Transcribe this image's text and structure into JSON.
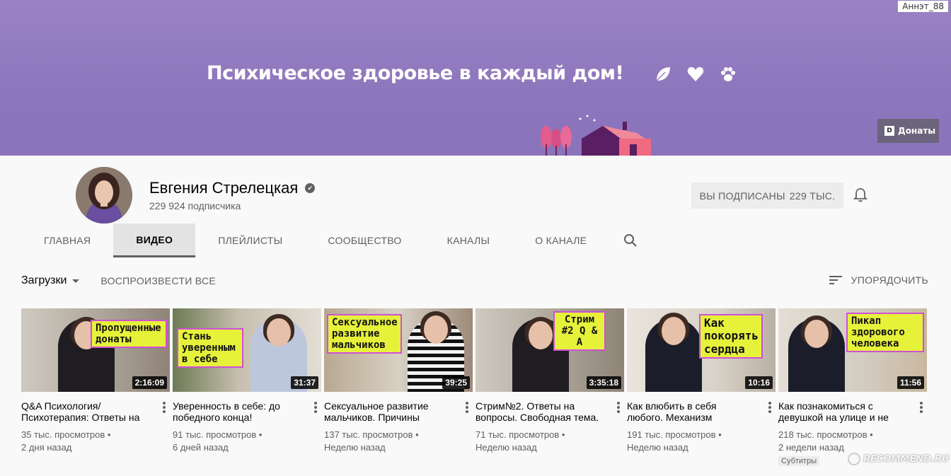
{
  "banner": {
    "tagline": "Психическое здоровье в каждый дом!",
    "user_label": "Аннэт_88",
    "donate_label": "Донаты",
    "donate_logo": "D",
    "icons": [
      "leaf-icon",
      "heart-icon",
      "paw-icon"
    ],
    "bg_color": "#9a82c4"
  },
  "channel": {
    "name": "Евгения Стрелецкая",
    "subscribers": "229 924 подписчика",
    "subscribed_label": "ВЫ ПОДПИСАНЫ",
    "subscribed_count": "229 ТЫС."
  },
  "tabs": [
    {
      "label": "ГЛАВНАЯ",
      "active": false
    },
    {
      "label": "ВИДЕО",
      "active": true
    },
    {
      "label": "ПЛЕЙЛИСТЫ",
      "active": false
    },
    {
      "label": "СООБЩЕСТВО",
      "active": false
    },
    {
      "label": "КАНАЛЫ",
      "active": false
    },
    {
      "label": "О КАНАЛЕ",
      "active": false
    }
  ],
  "filters": {
    "uploads": "Загрузки",
    "play_all": "ВОСПРОИЗВЕСТИ ВСЕ",
    "sort": "УПОРЯДОЧИТЬ"
  },
  "videos": [
    {
      "title": "Q&A Психология/ Психотерапия: Ответы на",
      "views": "35 тыс. просмотров •",
      "ago": "2 дня назад",
      "duration": "2:16:09",
      "sticker": "Пропущенные донаты",
      "badge": ""
    },
    {
      "title": "Уверенность в себе: до победного конца!",
      "views": "91 тыс. просмотров •",
      "ago": "6 дней назад",
      "duration": "31:37",
      "sticker": "Стань уверенным в себе",
      "badge": ""
    },
    {
      "title": "Сексуальное развитие мальчиков. Причины",
      "views": "137 тыс. просмотров •",
      "ago": "Неделю назад",
      "duration": "39:25",
      "sticker": "Сексуальное развитие мальчиков",
      "badge": ""
    },
    {
      "title": "Стрим№2. Ответы на вопросы. Свободная тема.",
      "views": "71 тыс. просмотров •",
      "ago": "Неделю назад",
      "duration": "3:35:18",
      "sticker": "Стрим #2 Q & A",
      "badge": ""
    },
    {
      "title": "Как влюбить в себя любого. Механизм",
      "views": "191 тыс. просмотров •",
      "ago": "Неделю назад",
      "duration": "10:16",
      "sticker": "Как покорять сердца",
      "badge": ""
    },
    {
      "title": "Как познакомиться с девушкой на улице и не",
      "views": "218 тыс. просмотров •",
      "ago": "2 недели назад",
      "duration": "11:56",
      "sticker": "Пикап здорового человека",
      "badge": "Субтитры"
    }
  ],
  "watermark": "RECOMMEND.RU",
  "colors": {
    "sticker": "#e6f23a",
    "sticker_border": "#d04fd7",
    "tab_active_bg": "#e3e3e3"
  }
}
